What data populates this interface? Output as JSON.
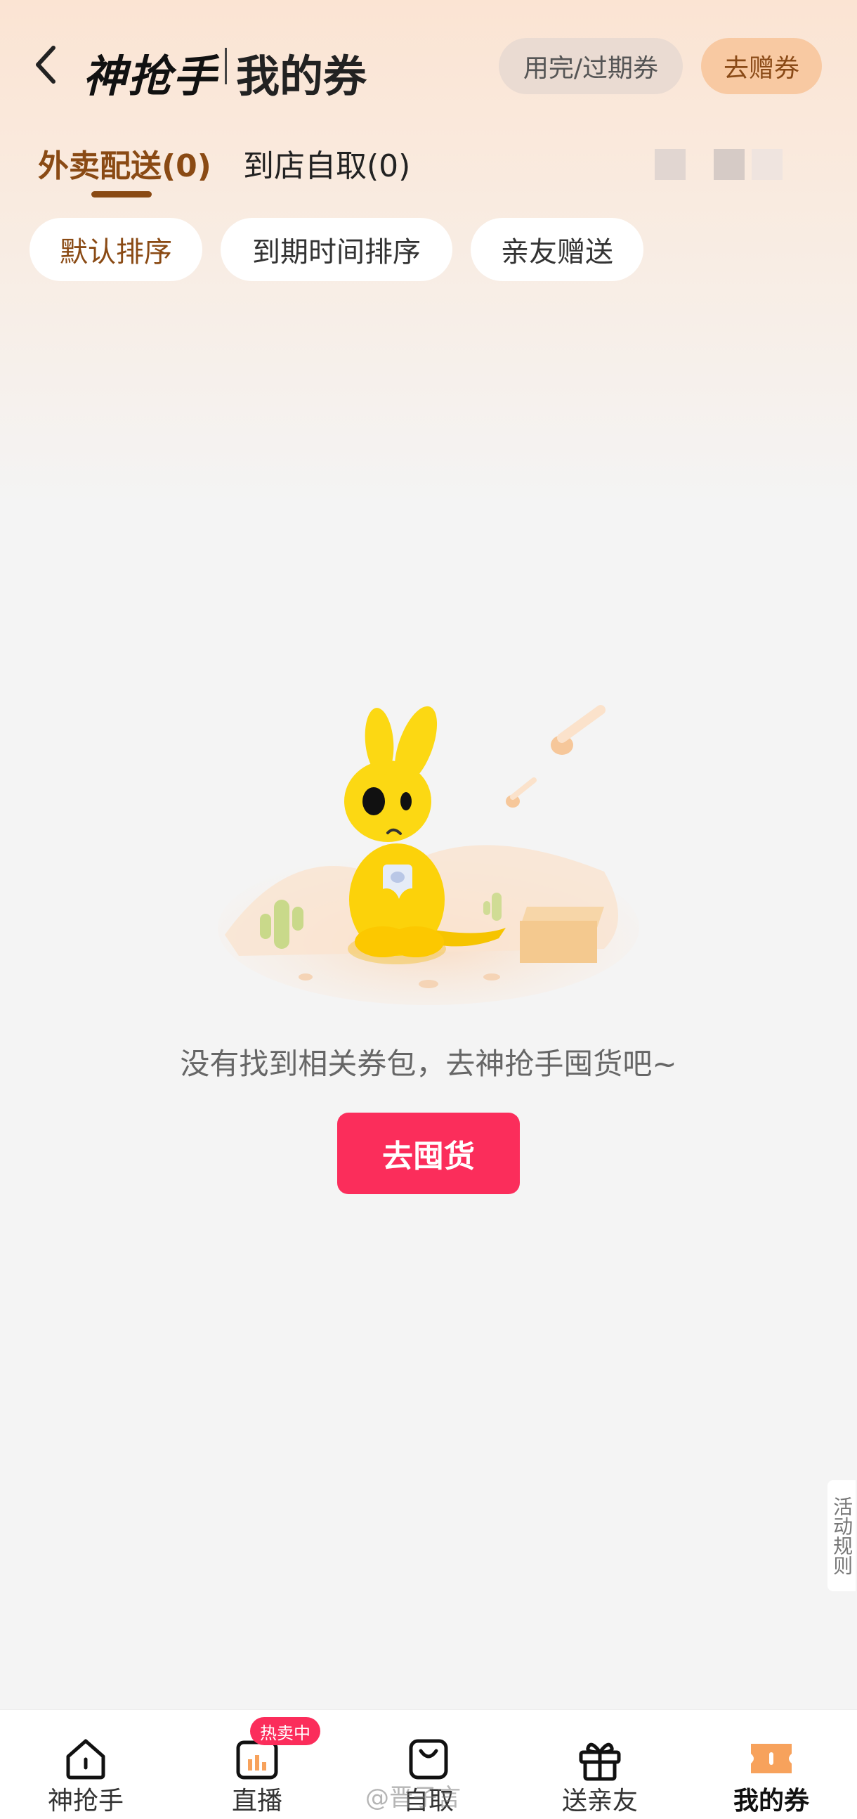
{
  "header": {
    "brand": "神抢手",
    "title": "我的券",
    "expired_btn": "用完/过期券",
    "gift_btn": "去赠券"
  },
  "tabs": [
    {
      "label": "外卖配送(0)",
      "active": true
    },
    {
      "label": "到店自取(0)",
      "active": false
    }
  ],
  "sort_chips": [
    {
      "label": "默认排序",
      "active": true
    },
    {
      "label": "到期时间排序",
      "active": false
    },
    {
      "label": "亲友赠送",
      "active": false
    }
  ],
  "empty_state": {
    "message": "没有找到相关券包，去神抢手囤货吧~",
    "action": "去囤货"
  },
  "side_tab": {
    "label": "活动规则"
  },
  "bottom_nav": [
    {
      "label": "神抢手",
      "icon": "home-icon"
    },
    {
      "label": "直播",
      "icon": "live-chart-icon",
      "badge": "热卖中"
    },
    {
      "label": "自取",
      "icon": "shopping-bag-icon"
    },
    {
      "label": "送亲友",
      "icon": "gift-icon"
    },
    {
      "label": "我的券",
      "icon": "coupon-icon",
      "active": true
    }
  ],
  "watermark": "@晋子言",
  "colors": {
    "accent_brown": "#8a4a14",
    "primary_red": "#fb2d5b",
    "coupon_orange": "#f7a25c"
  }
}
